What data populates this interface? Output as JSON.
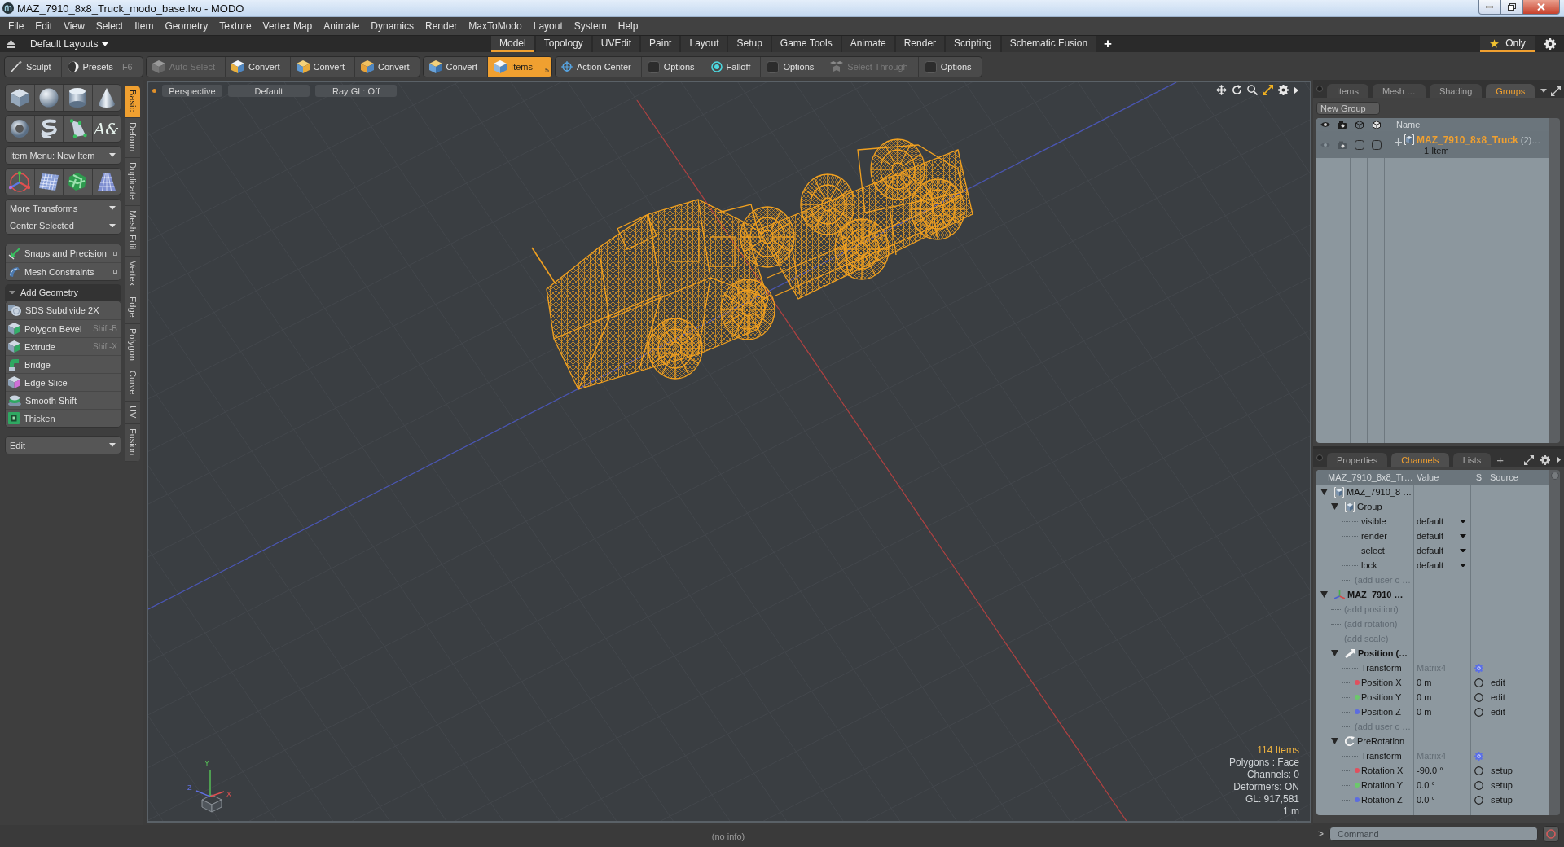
{
  "window": {
    "title": "MAZ_7910_8x8_Truck_modo_base.lxo - MODO"
  },
  "menu": [
    "File",
    "Edit",
    "View",
    "Select",
    "Item",
    "Geometry",
    "Texture",
    "Vertex Map",
    "Animate",
    "Dynamics",
    "Render",
    "MaxToModo",
    "Layout",
    "System",
    "Help"
  ],
  "layouts": {
    "preset": "Default Layouts",
    "tabs": [
      {
        "label": "Model",
        "selected": true
      },
      {
        "label": "Topology",
        "selected": false
      },
      {
        "label": "UVEdit",
        "selected": false
      },
      {
        "label": "Paint",
        "selected": false
      },
      {
        "label": "Layout",
        "selected": false
      },
      {
        "label": "Setup",
        "selected": false
      },
      {
        "label": "Game Tools",
        "selected": false
      },
      {
        "label": "Animate",
        "selected": false
      },
      {
        "label": "Render",
        "selected": false
      },
      {
        "label": "Scripting",
        "selected": false
      },
      {
        "label": "Schematic Fusion",
        "selected": false
      }
    ],
    "add": "+",
    "filter": {
      "label": "Only",
      "on": true
    }
  },
  "toolbar": [
    [
      {
        "kind": "sculpt",
        "label": "Sculpt",
        "selected": false,
        "disabled": false
      },
      {
        "kind": "presets",
        "label": "Presets",
        "shortcut": "F6",
        "selected": false,
        "disabled": false
      }
    ],
    [
      {
        "kind": "autoselect",
        "label": "Auto Select",
        "selected": false,
        "disabled": true
      },
      {
        "kind": "vertex",
        "label": "Convert",
        "selected": false,
        "disabled": false
      },
      {
        "kind": "edge",
        "label": "Convert",
        "selected": false,
        "disabled": false
      },
      {
        "kind": "polygon",
        "label": "Convert",
        "selected": false,
        "disabled": false
      }
    ],
    [
      {
        "kind": "material",
        "label": "Convert",
        "selected": false,
        "disabled": false
      },
      {
        "kind": "items",
        "label": "Items",
        "badge": "5",
        "selected": true,
        "disabled": false
      }
    ],
    [
      {
        "kind": "center",
        "label": "Action Center",
        "selected": false,
        "disabled": false
      },
      {
        "kind": "options",
        "label": "Options",
        "selected": false,
        "disabled": false
      },
      {
        "kind": "falloff",
        "label": "Falloff",
        "selected": false,
        "disabled": false
      },
      {
        "kind": "options",
        "label": "Options",
        "selected": false,
        "disabled": false
      },
      {
        "kind": "through",
        "label": "Select Through",
        "selected": false,
        "disabled": true
      },
      {
        "kind": "options",
        "label": "Options",
        "selected": false,
        "disabled": false
      }
    ]
  ],
  "palette": {
    "tabs": [
      {
        "label": "Basic",
        "selected": true
      },
      {
        "label": "Deform",
        "selected": false
      },
      {
        "label": "Duplicate",
        "selected": false
      },
      {
        "label": "Mesh Edit",
        "selected": false
      },
      {
        "label": "Vertex",
        "selected": false
      },
      {
        "label": "Edge",
        "selected": false
      },
      {
        "label": "Polygon",
        "selected": false
      },
      {
        "label": "Curve",
        "selected": false
      },
      {
        "label": "UV",
        "selected": false
      },
      {
        "label": "Fusion",
        "selected": false
      }
    ],
    "blocks": [
      {
        "kind": "primitives"
      },
      {
        "kind": "shapes",
        "glyph": "A&"
      },
      {
        "kind": "menus",
        "items": [
          "Item Menu: New Item"
        ]
      },
      {
        "kind": "transforms"
      },
      {
        "kind": "menus",
        "items": [
          "More Transforms",
          "Center Selected"
        ]
      },
      {
        "kind": "options",
        "items": [
          {
            "kind": "snap",
            "label": "Snaps and Precision"
          },
          {
            "kind": "constraint",
            "label": "Mesh Constraints"
          }
        ]
      },
      {
        "kind": "section",
        "label": "Add Geometry",
        "expanded": true
      },
      {
        "kind": "tools",
        "items": [
          {
            "kind": "subdivide",
            "label": "SDS Subdivide 2X"
          },
          {
            "kind": "bevel",
            "label": "Polygon Bevel",
            "shortcut": "Shift-B"
          },
          {
            "kind": "extrude",
            "label": "Extrude",
            "shortcut": "Shift-X"
          },
          {
            "kind": "bridge",
            "label": "Bridge"
          },
          {
            "kind": "slice",
            "label": "Edge Slice"
          },
          {
            "kind": "shift",
            "label": "Smooth Shift"
          },
          {
            "kind": "thicken",
            "label": "Thicken"
          }
        ]
      },
      {
        "kind": "menus",
        "items": [
          "Edit"
        ]
      }
    ]
  },
  "viewport": {
    "header": [
      "Perspective",
      "Default",
      "Ray GL: Off"
    ],
    "stats": [
      {
        "text": "114 Items",
        "highlight": true
      },
      {
        "text": "Polygons : Face",
        "highlight": false
      },
      {
        "text": "Channels: 0",
        "highlight": false
      },
      {
        "text": "Deformers: ON",
        "highlight": false
      },
      {
        "text": "GL: 917,581",
        "highlight": false
      },
      {
        "text": "1 m",
        "highlight": false
      }
    ],
    "axes": [
      "Y",
      "X",
      "Z"
    ]
  },
  "status": "(no info)",
  "groups_panel": {
    "tabs": [
      {
        "label": "Items",
        "selected": false
      },
      {
        "label": "Mesh …",
        "selected": false
      },
      {
        "label": "Shading",
        "selected": false
      },
      {
        "label": "Groups",
        "selected": true
      }
    ],
    "new_group": "New Group",
    "column": "Name",
    "rows": [
      {
        "name": "MAZ_7910_8x8_Truck",
        "suffix": "(2)…",
        "detail": "1 Item",
        "selected": true,
        "expanded": false
      }
    ]
  },
  "channels_panel": {
    "tabs": [
      {
        "label": "Properties",
        "selected": false
      },
      {
        "label": "Channels",
        "selected": true
      },
      {
        "label": "Lists",
        "selected": false
      }
    ],
    "add": "+",
    "columns": [
      "MAZ_7910_8x8_Tr…",
      "Value",
      "S",
      "Source"
    ],
    "tree": [
      {
        "kind": "mesh",
        "name": "MAZ_7910_8 …",
        "expanded": true,
        "children": [
          {
            "kind": "group",
            "name": "Group",
            "expanded": true,
            "children": [
              {
                "kind": "option",
                "name": "visible",
                "value": "default"
              },
              {
                "kind": "option",
                "name": "render",
                "value": "default"
              },
              {
                "kind": "option",
                "name": "select",
                "value": "default"
              },
              {
                "kind": "option",
                "name": "lock",
                "value": "default"
              },
              {
                "kind": "add",
                "name": "(add user c …"
              }
            ]
          }
        ]
      },
      {
        "kind": "locator",
        "name": "MAZ_7910 …",
        "expanded": true,
        "children": [
          {
            "kind": "add",
            "name": "(add position)"
          },
          {
            "kind": "add",
            "name": "(add rotation)"
          },
          {
            "kind": "add",
            "name": "(add scale)"
          },
          {
            "kind": "position",
            "name": "Position (…",
            "expanded": true,
            "children": [
              {
                "kind": "matrix",
                "name": "Transform",
                "value": "Matrix4"
              },
              {
                "kind": "channel",
                "name": "Position X",
                "value": "0 m",
                "color": "#e0505e",
                "source": "edit"
              },
              {
                "kind": "channel",
                "name": "Position Y",
                "value": "0 m",
                "color": "#6cc86c",
                "source": "edit"
              },
              {
                "kind": "channel",
                "name": "Position Z",
                "value": "0 m",
                "color": "#5c6ce0",
                "source": "edit"
              },
              {
                "kind": "add",
                "name": "(add user c …"
              }
            ]
          },
          {
            "kind": "rotation",
            "name": "PreRotation",
            "expanded": true,
            "children": [
              {
                "kind": "matrix",
                "name": "Transform",
                "value": "Matrix4"
              },
              {
                "kind": "channel",
                "name": "Rotation X",
                "value": "-90.0 °",
                "color": "#e0505e",
                "source": "setup"
              },
              {
                "kind": "channel",
                "name": "Rotation Y",
                "value": "0.0 °",
                "color": "#6cc86c",
                "source": "setup"
              },
              {
                "kind": "channel",
                "name": "Rotation Z",
                "value": "0.0 °",
                "color": "#5c6ce0",
                "source": "setup"
              }
            ]
          }
        ]
      }
    ]
  },
  "command": {
    "prompt": ">",
    "placeholder": "Command"
  }
}
